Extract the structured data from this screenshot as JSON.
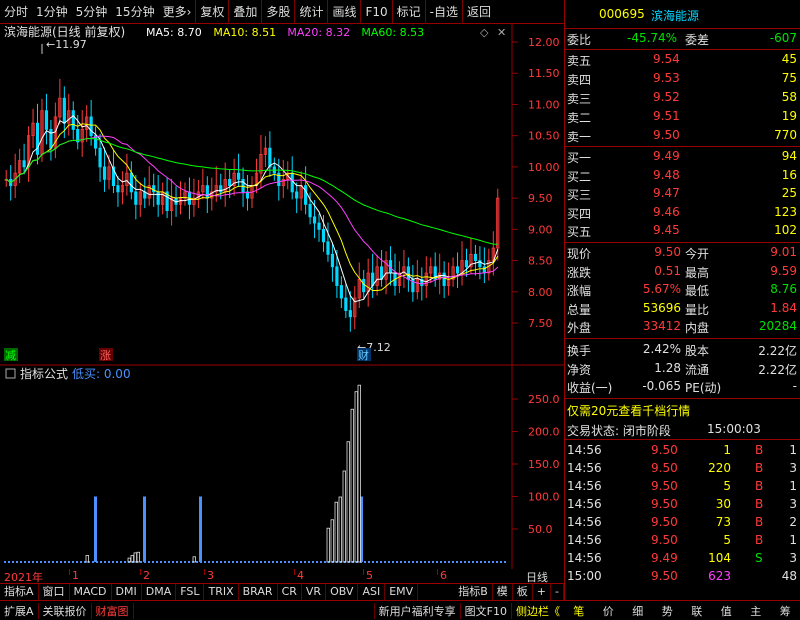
{
  "toolbar": {
    "items": [
      "分时",
      "1分钟",
      "5分钟",
      "15分钟",
      "更多›",
      "复权",
      "叠加",
      "多股",
      "统计",
      "画线",
      "F10",
      "标记",
      "-自选",
      "返回"
    ]
  },
  "chart": {
    "title": "滨海能源(日线 前复权)",
    "ma": [
      {
        "label": "MA5: 8.70",
        "color": "#ffffff"
      },
      {
        "label": "MA10: 8.51",
        "color": "#ffff00"
      },
      {
        "label": "MA20: 8.32",
        "color": "#ff40ff"
      },
      {
        "label": "MA60: 8.53",
        "color": "#00ff00"
      }
    ],
    "y_ticks": [
      "12.00",
      "11.50",
      "11.00",
      "10.50",
      "10.00",
      "9.50",
      "9.00",
      "8.50",
      "8.00",
      "7.50"
    ],
    "high_label": "11.97",
    "low_label": "7.12",
    "marker_jian": "减",
    "marker_zhang": "涨",
    "marker_cai": "财",
    "indicator_title": "指标公式",
    "indicator_value": "低买: 0.00",
    "ind_ticks": [
      "250.0",
      "200.0",
      "150.0",
      "100.0",
      "50.0"
    ],
    "x_labels": [
      "2021年",
      "1",
      "2",
      "3",
      "4",
      "5",
      "6"
    ],
    "period": "日线"
  },
  "subtabs": [
    "指标A",
    "窗口",
    "MACD",
    "DMI",
    "DMA",
    "FSL",
    "TRIX",
    "BRAR",
    "CR",
    "VR",
    "OBV",
    "ASI",
    "EMV",
    "指标B",
    "模",
    "板",
    "+",
    "-"
  ],
  "bottom": {
    "left": [
      "扩展A",
      "关联报价",
      "财富图"
    ],
    "right": [
      "新用户福利专享",
      "图文F10",
      "侧边栏《"
    ],
    "right_tabs": [
      "笔",
      "价",
      "细",
      "势",
      "联",
      "值",
      "主",
      "筹"
    ]
  },
  "quote": {
    "code": "000695",
    "name": "滨海能源",
    "weibi_label": "委比",
    "weibi": "-45.74%",
    "weicha_label": "委差",
    "weicha": "-607",
    "asks": [
      {
        "label": "卖五",
        "price": "9.54",
        "vol": "45"
      },
      {
        "label": "卖四",
        "price": "9.53",
        "vol": "75"
      },
      {
        "label": "卖三",
        "price": "9.52",
        "vol": "58"
      },
      {
        "label": "卖二",
        "price": "9.51",
        "vol": "19"
      },
      {
        "label": "卖一",
        "price": "9.50",
        "vol": "770"
      }
    ],
    "bids": [
      {
        "label": "买一",
        "price": "9.49",
        "vol": "94"
      },
      {
        "label": "买二",
        "price": "9.48",
        "vol": "16"
      },
      {
        "label": "买三",
        "price": "9.47",
        "vol": "25"
      },
      {
        "label": "买四",
        "price": "9.46",
        "vol": "123"
      },
      {
        "label": "买五",
        "price": "9.45",
        "vol": "102"
      }
    ],
    "stats": [
      {
        "l1": "现价",
        "v1": "9.50",
        "c1": "red",
        "l2": "今开",
        "v2": "9.01",
        "c2": "red"
      },
      {
        "l1": "涨跌",
        "v1": "0.51",
        "c1": "red",
        "l2": "最高",
        "v2": "9.59",
        "c2": "red"
      },
      {
        "l1": "涨幅",
        "v1": "5.67%",
        "c1": "red",
        "l2": "最低",
        "v2": "8.76",
        "c2": "grn"
      },
      {
        "l1": "总量",
        "v1": "53696",
        "c1": "yel",
        "l2": "量比",
        "v2": "1.84",
        "c2": "red"
      },
      {
        "l1": "外盘",
        "v1": "33412",
        "c1": "red",
        "l2": "内盘",
        "v2": "20284",
        "c2": "grn"
      }
    ],
    "stats2": [
      {
        "l1": "换手",
        "v1": "2.42%",
        "l2": "股本",
        "v2": "2.22亿"
      },
      {
        "l1": "净资",
        "v1": "1.28",
        "l2": "流通",
        "v2": "2.22亿"
      },
      {
        "l1": "收益(一)",
        "v1": "-0.065",
        "l2": "PE(动)",
        "v2": "-"
      }
    ],
    "promo": "仅需20元查看千档行情",
    "status_label": "交易状态: 闭市阶段",
    "status_time": "15:00:03",
    "ticks": [
      {
        "t": "14:56",
        "p": "9.50",
        "v": "1",
        "s": "B",
        "n": "1"
      },
      {
        "t": "14:56",
        "p": "9.50",
        "v": "220",
        "s": "B",
        "n": "3"
      },
      {
        "t": "14:56",
        "p": "9.50",
        "v": "5",
        "s": "B",
        "n": "1"
      },
      {
        "t": "14:56",
        "p": "9.50",
        "v": "30",
        "s": "B",
        "n": "3"
      },
      {
        "t": "14:56",
        "p": "9.50",
        "v": "73",
        "s": "B",
        "n": "2"
      },
      {
        "t": "14:56",
        "p": "9.50",
        "v": "5",
        "s": "B",
        "n": "1"
      },
      {
        "t": "14:56",
        "p": "9.49",
        "v": "104",
        "s": "S",
        "n": "3"
      },
      {
        "t": "15:00",
        "p": "9.50",
        "v": "623",
        "s": "",
        "n": "48"
      }
    ]
  },
  "colors": {
    "border": "#990000",
    "up": "#ff3a3a",
    "down": "#00e000",
    "blue": "#4a90ff"
  }
}
